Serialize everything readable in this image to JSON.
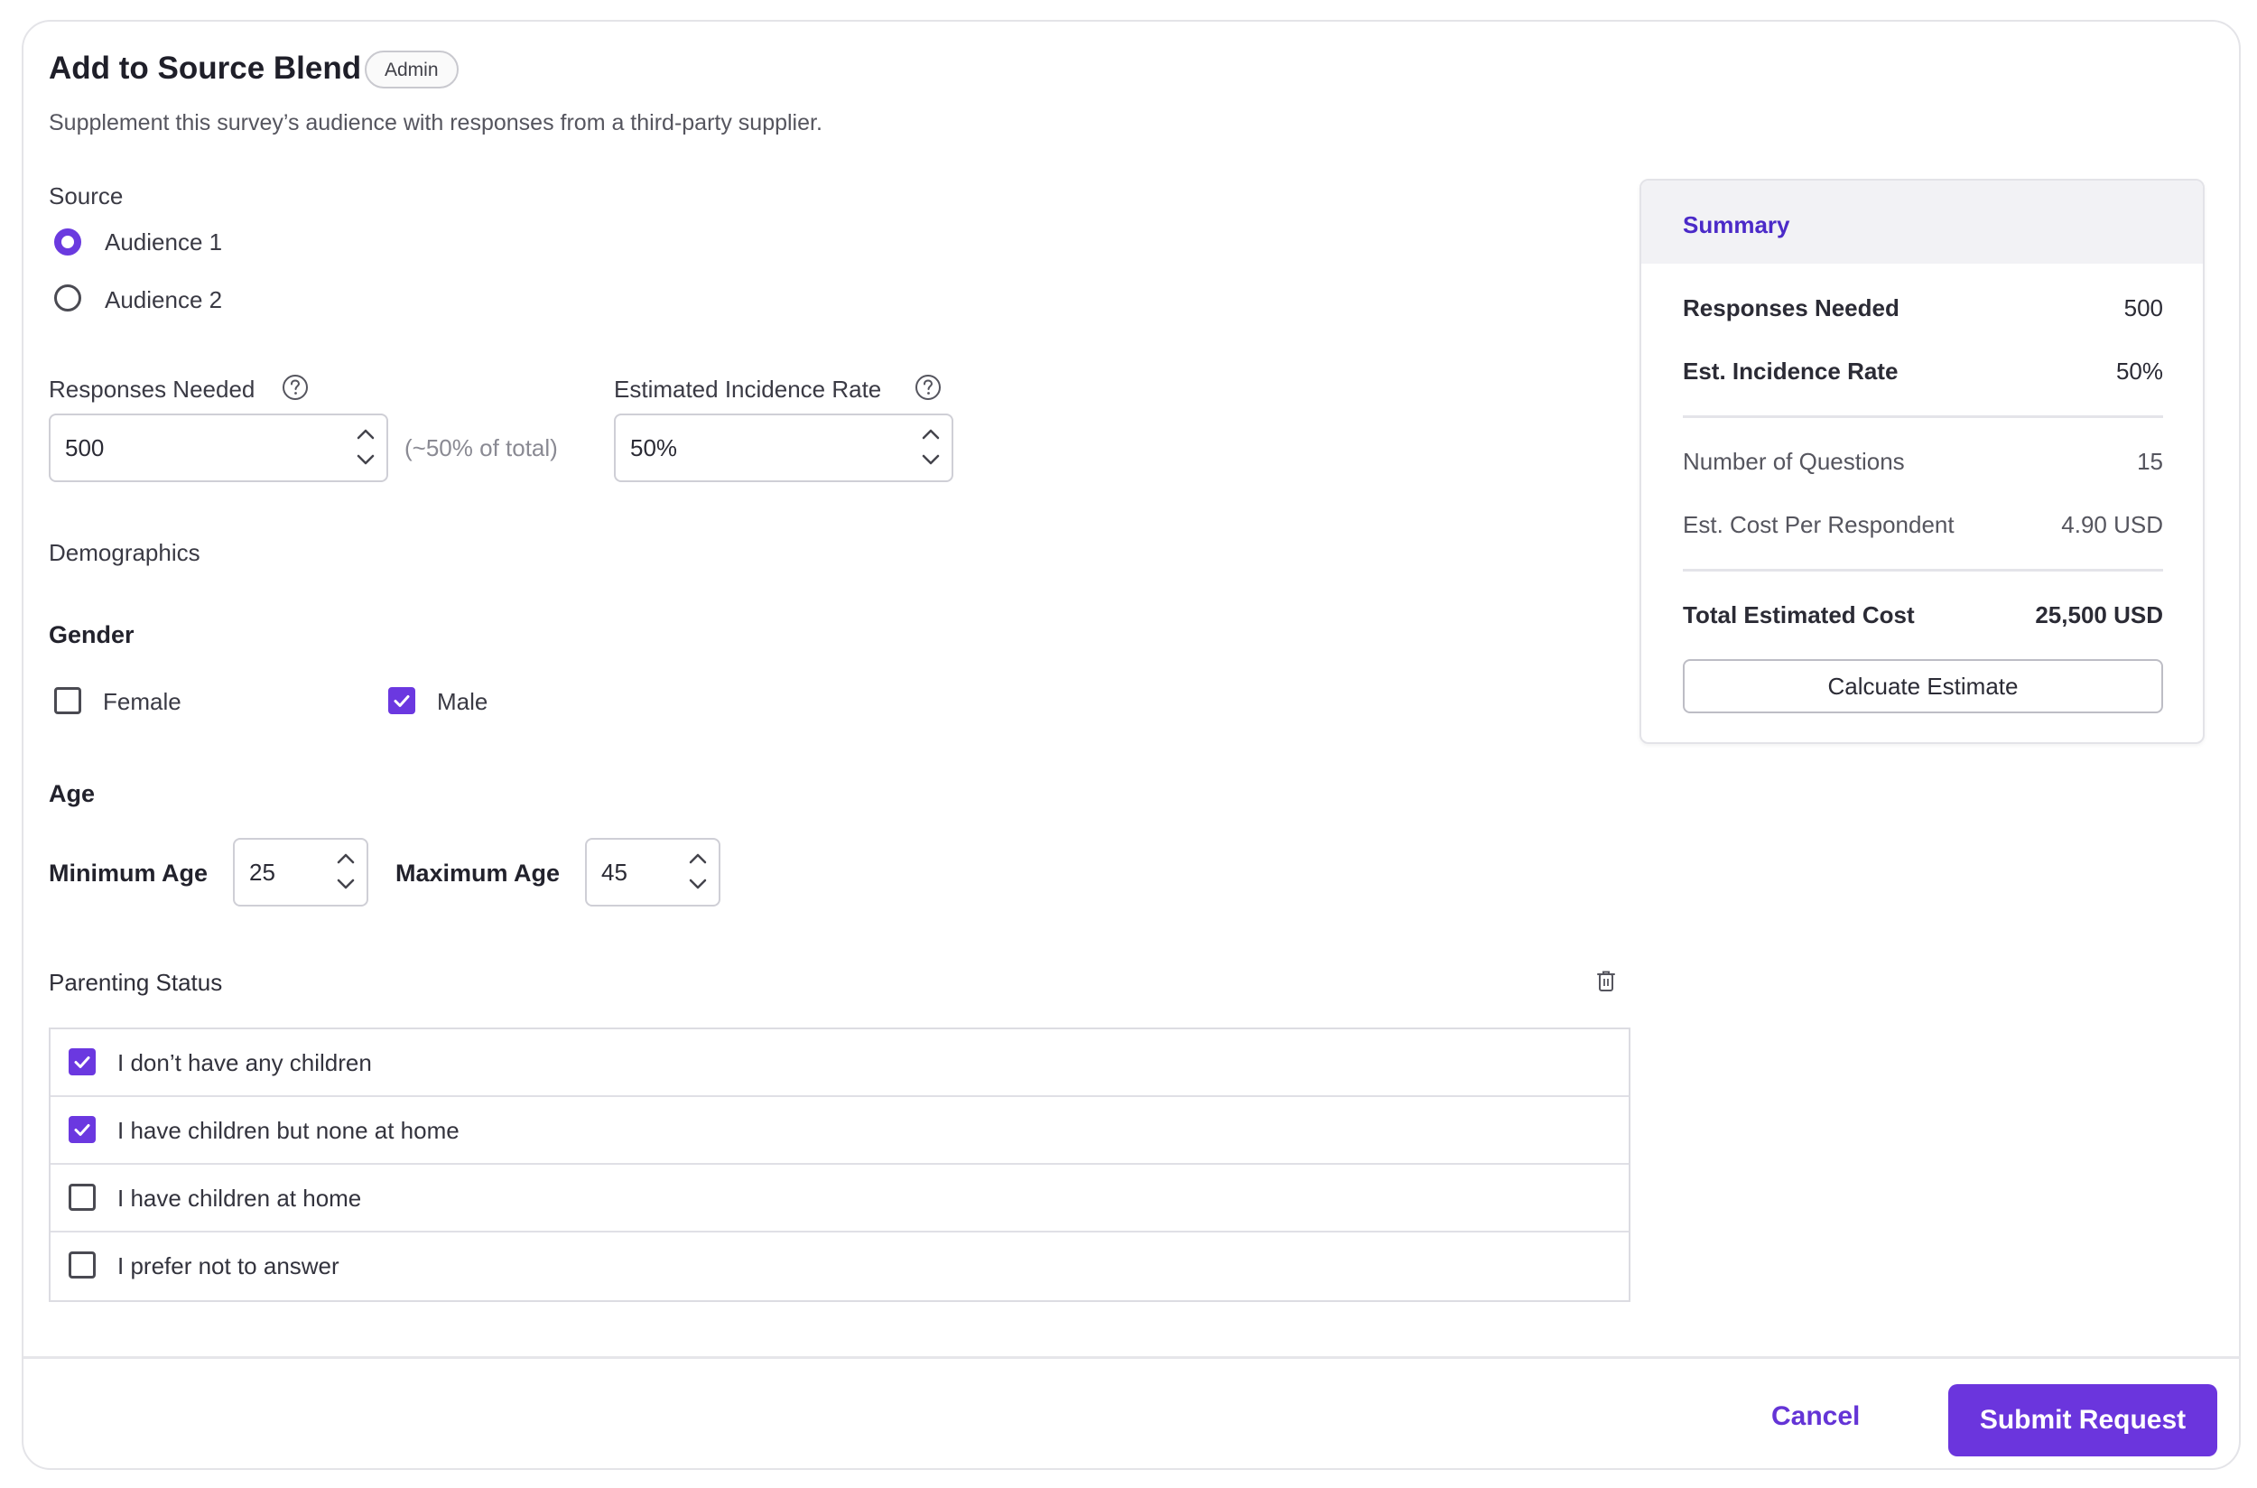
{
  "header": {
    "title": "Add to Source Blend",
    "badge": "Admin",
    "subtitle": "Supplement this survey’s audience with responses from a third-party supplier."
  },
  "source": {
    "label": "Source",
    "options": [
      {
        "label": "Audience 1",
        "selected": true
      },
      {
        "label": "Audience 2",
        "selected": false
      }
    ]
  },
  "responses": {
    "label": "Responses Needed",
    "value": "500",
    "hint": "(~50% of total)"
  },
  "incidence": {
    "label": "Estimated Incidence Rate",
    "value": "50%"
  },
  "demographics": {
    "label": "Demographics",
    "gender": {
      "label": "Gender",
      "options": [
        {
          "label": "Female",
          "checked": false
        },
        {
          "label": "Male",
          "checked": true
        }
      ]
    },
    "age": {
      "label": "Age",
      "min_label": "Minimum Age",
      "min_value": "25",
      "max_label": "Maximum Age",
      "max_value": "45"
    },
    "parenting": {
      "label": "Parenting Status",
      "options": [
        {
          "label": "I don’t have any children",
          "checked": true
        },
        {
          "label": "I have children but none at home",
          "checked": true
        },
        {
          "label": "I have children at home",
          "checked": false
        },
        {
          "label": "I prefer not to answer",
          "checked": false
        }
      ]
    }
  },
  "summary": {
    "title": "Summary",
    "rows": [
      {
        "key": "Responses Needed",
        "value": "500"
      },
      {
        "key": "Est. Incidence Rate",
        "value": "50%"
      },
      {
        "key": "Number of Questions",
        "value": "15"
      },
      {
        "key": "Est. Cost Per Respondent",
        "value": "4.90 USD"
      },
      {
        "key": "Total Estimated Cost",
        "value": "25,500 USD"
      }
    ],
    "calc_button": "Calcuate Estimate"
  },
  "footer": {
    "cancel": "Cancel",
    "submit": "Submit Request"
  },
  "colors": {
    "accent": "#6b35dd",
    "summary_title": "#4b2ac8"
  }
}
